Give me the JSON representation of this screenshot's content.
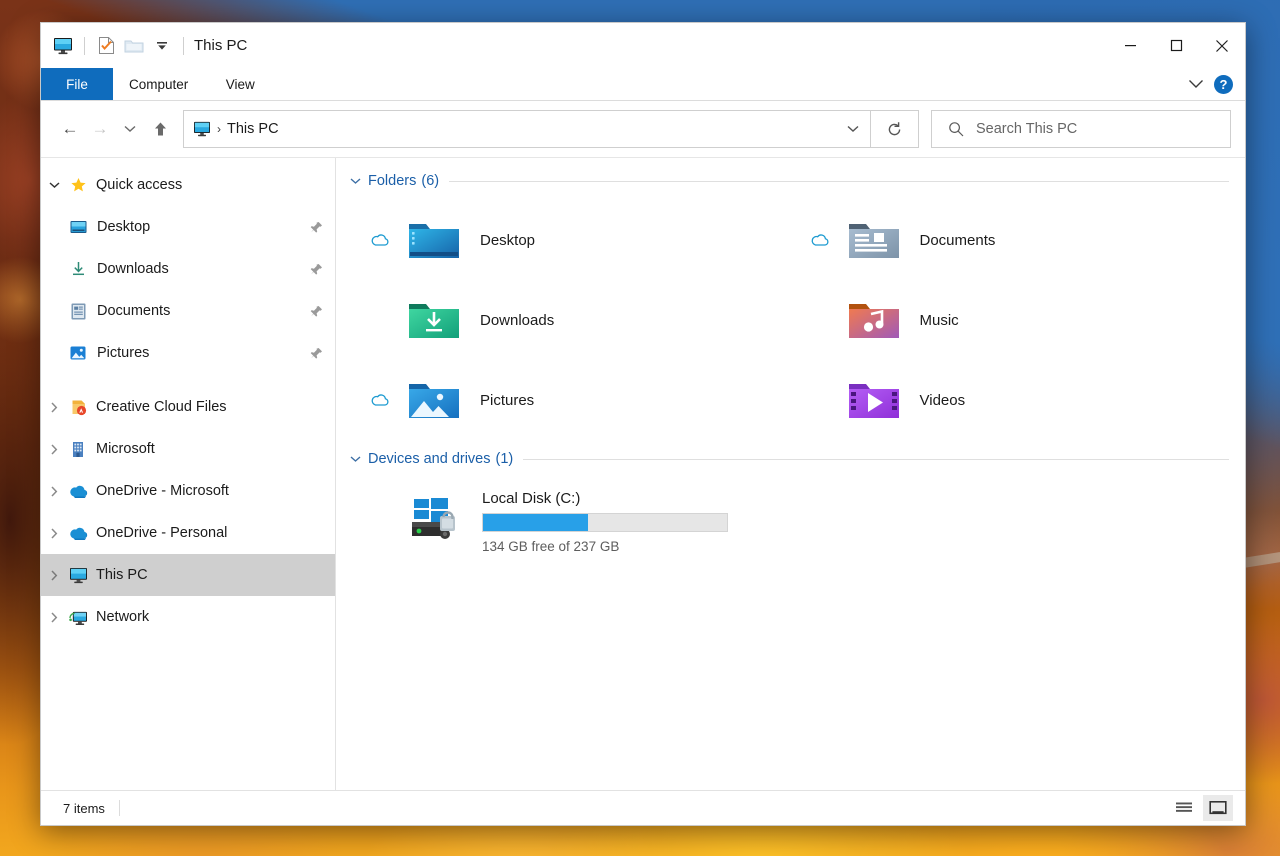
{
  "window": {
    "title": "This PC",
    "titlebar_icons": [
      "this-pc-icon",
      "properties-icon",
      "new-folder-icon",
      "customize-dropdown-icon"
    ],
    "controls": {
      "minimize": "–",
      "maximize": "□",
      "close": "✕"
    }
  },
  "ribbon": {
    "tabs": [
      {
        "label": "File",
        "active_style": "file"
      },
      {
        "label": "Computer",
        "active_style": "normal"
      },
      {
        "label": "View",
        "active_style": "normal"
      }
    ],
    "expand_label": "∨",
    "help_label": "?"
  },
  "toolbar": {
    "back": "←",
    "forward": "→",
    "recent": "∨",
    "up": "↑",
    "breadcrumb": {
      "icon": "this-pc-icon",
      "separator": "›",
      "text": "This PC"
    },
    "address_dropdown": "∨",
    "refresh": "↻"
  },
  "search": {
    "placeholder": "Search This PC",
    "icon": "search-icon"
  },
  "sidebar": {
    "items": [
      {
        "label": "Quick access",
        "icon": "star-icon",
        "chevron": "⌄",
        "expanded": true,
        "child": false,
        "pinned": false,
        "selected": false
      },
      {
        "label": "Desktop",
        "icon": "desktop-folder-icon",
        "chevron": "",
        "expanded": false,
        "child": true,
        "pinned": true,
        "selected": false
      },
      {
        "label": "Downloads",
        "icon": "downloads-icon",
        "chevron": "",
        "expanded": false,
        "child": true,
        "pinned": true,
        "selected": false
      },
      {
        "label": "Documents",
        "icon": "documents-icon",
        "chevron": "",
        "expanded": false,
        "child": true,
        "pinned": true,
        "selected": false
      },
      {
        "label": "Pictures",
        "icon": "pictures-icon",
        "chevron": "",
        "expanded": false,
        "child": true,
        "pinned": true,
        "selected": false
      },
      {
        "label": "Creative Cloud Files",
        "icon": "creative-cloud-icon",
        "chevron": "›",
        "expanded": false,
        "child": false,
        "pinned": false,
        "selected": false
      },
      {
        "label": "Microsoft",
        "icon": "building-icon",
        "chevron": "›",
        "expanded": false,
        "child": false,
        "pinned": false,
        "selected": false
      },
      {
        "label": "OneDrive - Microsoft",
        "icon": "onedrive-icon",
        "chevron": "›",
        "expanded": false,
        "child": false,
        "pinned": false,
        "selected": false
      },
      {
        "label": "OneDrive - Personal",
        "icon": "onedrive-icon",
        "chevron": "›",
        "expanded": false,
        "child": false,
        "pinned": false,
        "selected": false
      },
      {
        "label": "This PC",
        "icon": "this-pc-icon",
        "chevron": "›",
        "expanded": false,
        "child": false,
        "pinned": false,
        "selected": true
      },
      {
        "label": "Network",
        "icon": "network-icon",
        "chevron": "›",
        "expanded": false,
        "child": false,
        "pinned": false,
        "selected": false
      }
    ],
    "pin_glyph": "📌"
  },
  "content": {
    "groups": [
      {
        "title": "Folders",
        "count": "(6)",
        "chevron": "⌄"
      },
      {
        "title": "Devices and drives",
        "count": "(1)",
        "chevron": "⌄"
      }
    ],
    "folders": [
      {
        "label": "Desktop",
        "icon": "desktop-folder-icon",
        "cloud": true
      },
      {
        "label": "Documents",
        "icon": "documents-folder-icon",
        "cloud": true
      },
      {
        "label": "Downloads",
        "icon": "downloads-folder-icon",
        "cloud": false
      },
      {
        "label": "Music",
        "icon": "music-folder-icon",
        "cloud": false
      },
      {
        "label": "Pictures",
        "icon": "pictures-folder-icon",
        "cloud": true
      },
      {
        "label": "Videos",
        "icon": "videos-folder-icon",
        "cloud": false
      }
    ],
    "drives": [
      {
        "name": "Local Disk (C:)",
        "icon": "windows-drive-icon",
        "capacity_text": "134 GB free of 237 GB",
        "free_gb": 134,
        "total_gb": 237,
        "used_percent": 43,
        "bar_color": "#28a0e8"
      }
    ]
  },
  "statusbar": {
    "item_count": "7 items",
    "views": [
      {
        "name": "details-view-icon",
        "active": false
      },
      {
        "name": "large-icons-view-icon",
        "active": true
      }
    ]
  },
  "colors": {
    "accent": "#0f6cbd",
    "link": "#1b5fa8",
    "selection": "#cfcfcf",
    "progress": "#28a0e8"
  }
}
